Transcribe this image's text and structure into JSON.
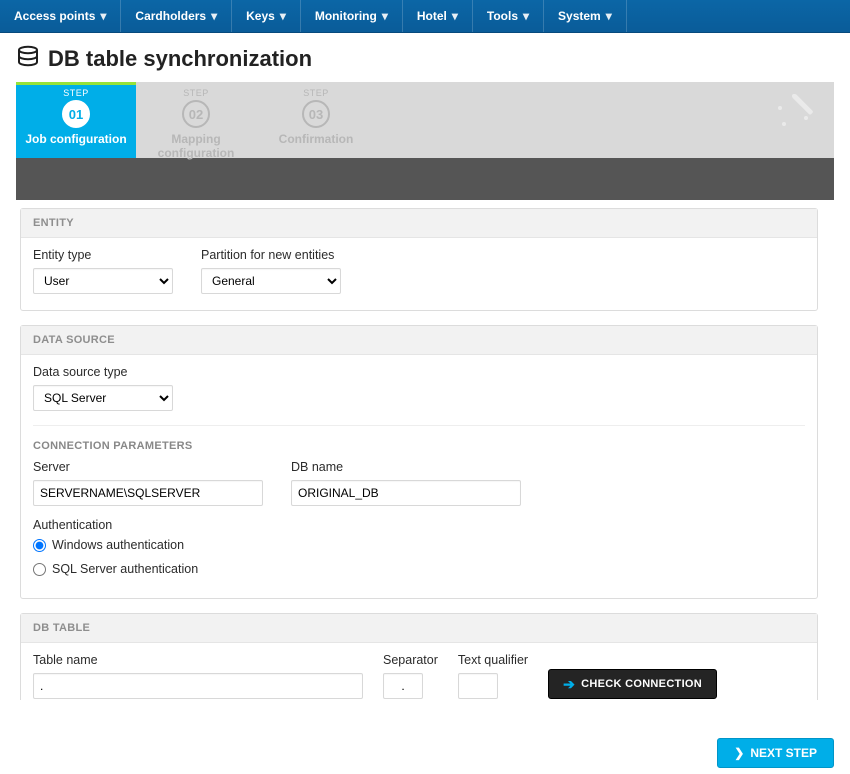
{
  "nav": {
    "items": [
      {
        "label": "Access points"
      },
      {
        "label": "Cardholders"
      },
      {
        "label": "Keys"
      },
      {
        "label": "Monitoring"
      },
      {
        "label": "Hotel"
      },
      {
        "label": "Tools"
      },
      {
        "label": "System"
      }
    ]
  },
  "page": {
    "title": "DB table synchronization"
  },
  "wizard": {
    "step_eyebrow": "STEP",
    "steps": [
      {
        "num": "01",
        "label": "Job configuration",
        "active": true
      },
      {
        "num": "02",
        "label": "Mapping configuration",
        "active": false
      },
      {
        "num": "03",
        "label": "Confirmation",
        "active": false
      }
    ]
  },
  "entity": {
    "panel_title": "ENTITY",
    "entity_type_label": "Entity type",
    "entity_type_value": "User",
    "partition_label": "Partition for new entities",
    "partition_value": "General"
  },
  "datasource": {
    "panel_title": "DATA SOURCE",
    "type_label": "Data source type",
    "type_value": "SQL Server",
    "conn_params_title": "CONNECTION PARAMETERS",
    "server_label": "Server",
    "server_value": "SERVERNAME\\SQLSERVER",
    "dbname_label": "DB name",
    "dbname_value": "ORIGINAL_DB",
    "auth_label": "Authentication",
    "auth_windows": "Windows authentication",
    "auth_sql": "SQL Server authentication",
    "auth_selected": "windows"
  },
  "dbtable": {
    "panel_title": "DB TABLE",
    "tablename_label": "Table name",
    "tablename_value": ".",
    "separator_label": "Separator",
    "separator_value": ".",
    "qualifier_label": "Text qualifier",
    "qualifier_value": "",
    "check_button": "CHECK CONNECTION"
  },
  "footer": {
    "next": "NEXT STEP"
  }
}
